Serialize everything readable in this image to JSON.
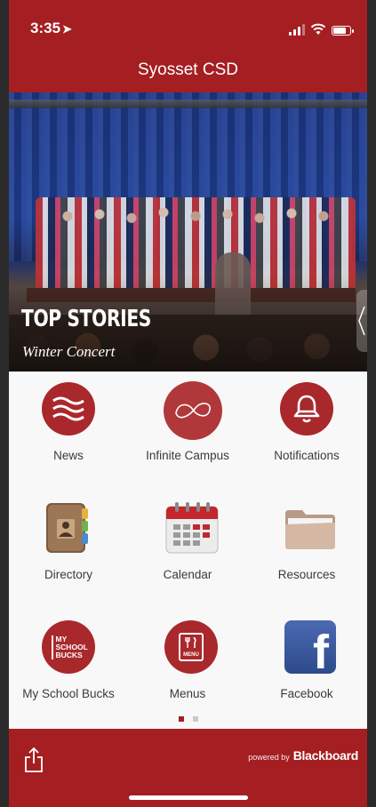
{
  "status_bar": {
    "time": "3:35",
    "location_arrow": "➤"
  },
  "header": {
    "title": "Syosset CSD"
  },
  "hero": {
    "heading": "TOP STORIES",
    "caption": "Winter Concert"
  },
  "tiles": [
    {
      "label": "News",
      "icon": "news-waves-icon"
    },
    {
      "label": "Infinite Campus",
      "icon": "infinite-campus-icon"
    },
    {
      "label": "Notifications",
      "icon": "bell-icon"
    },
    {
      "label": "Directory",
      "icon": "address-book-icon"
    },
    {
      "label": "Calendar",
      "icon": "calendar-icon"
    },
    {
      "label": "Resources",
      "icon": "folder-icon"
    },
    {
      "label": "My School Bucks",
      "icon": "my-school-bucks-icon",
      "icon_text": "MY SCHOOL BUCKS"
    },
    {
      "label": "Menus",
      "icon": "menu-icon",
      "icon_text": "MENU"
    },
    {
      "label": "Facebook",
      "icon": "facebook-icon",
      "icon_text": "f"
    }
  ],
  "pager": {
    "pages": 2,
    "active": 1
  },
  "footer": {
    "powered_by": "powered by",
    "brand": "Blackboard"
  },
  "colors": {
    "brand_red": "#a51e22",
    "icon_red": "#a9282c",
    "facebook_blue": "#3b5998"
  }
}
